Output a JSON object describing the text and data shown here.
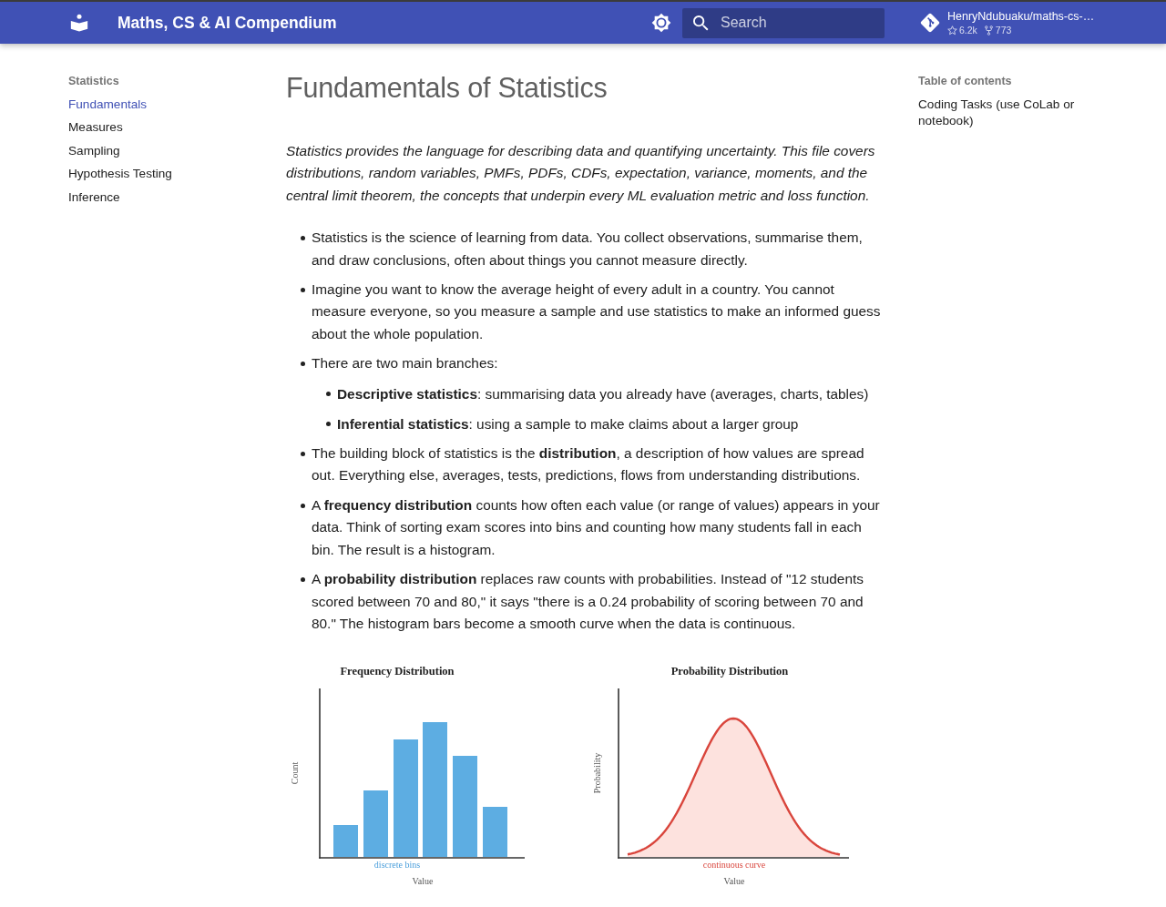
{
  "header": {
    "title": "Maths, CS & AI Compendium",
    "search": {
      "placeholder": "Search"
    },
    "repo": {
      "name": "HenryNdubuaku/maths-cs-…",
      "stars": "6.2k",
      "forks": "773"
    }
  },
  "sidebar": {
    "heading": "Statistics",
    "items": [
      {
        "label": "Fundamentals",
        "selected": true
      },
      {
        "label": "Measures",
        "selected": false
      },
      {
        "label": "Sampling",
        "selected": false
      },
      {
        "label": "Hypothesis Testing",
        "selected": false
      },
      {
        "label": "Inference",
        "selected": false
      }
    ]
  },
  "content": {
    "title": "Fundamentals of Statistics",
    "intro": "Statistics provides the language for describing data and quantifying uncertainty. This file covers distributions, random variables, PMFs, PDFs, CDFs, expectation, variance, moments, and the central limit theorem, the concepts that underpin every ML evaluation metric and loss function.",
    "bullets": [
      {
        "text": "Statistics is the science of learning from data. You collect observations, summarise them, and draw conclusions, often about things you cannot measure directly."
      },
      {
        "text": "Imagine you want to know the average height of every adult in a country. You cannot measure everyone, so you measure a sample and use statistics to make an informed guess about the whole population."
      },
      {
        "text": "There are two main branches:",
        "children": [
          {
            "text": "**Descriptive statistics**: summarising data you already have (averages, charts, tables)"
          },
          {
            "text": "**Inferential statistics**: using a sample to make claims about a larger group"
          }
        ]
      },
      {
        "text": "The building block of statistics is the **distribution**, a description of how values are spread out. Everything else, averages, tests, predictions, flows from understanding distributions."
      },
      {
        "text": "A **frequency distribution** counts how often each value (or range of values) appears in your data. Think of sorting exam scores into bins and counting how many students fall in each bin. The result is a histogram."
      },
      {
        "text": "A **probability distribution** replaces raw counts with probabilities. Instead of \"12 students scored between 70 and 80,\" it says \"there is a 0.24 probability of scoring between 70 and 80.\" The histogram bars become a smooth curve when the data is continuous."
      }
    ],
    "figure": {
      "panels": [
        {
          "kind": "histogram",
          "title": "Frequency Distribution",
          "ylabel": "Count",
          "note": "discrete bins",
          "xlabel": "Value"
        },
        {
          "kind": "curve",
          "title": "Probability Distribution",
          "ylabel": "Probability",
          "note": "continuous curve",
          "xlabel": "Value"
        }
      ]
    }
  },
  "toc": {
    "heading": "Table of contents",
    "items": [
      {
        "label": "Coding Tasks (use CoLab or notebook)",
        "selected": false
      }
    ]
  }
}
